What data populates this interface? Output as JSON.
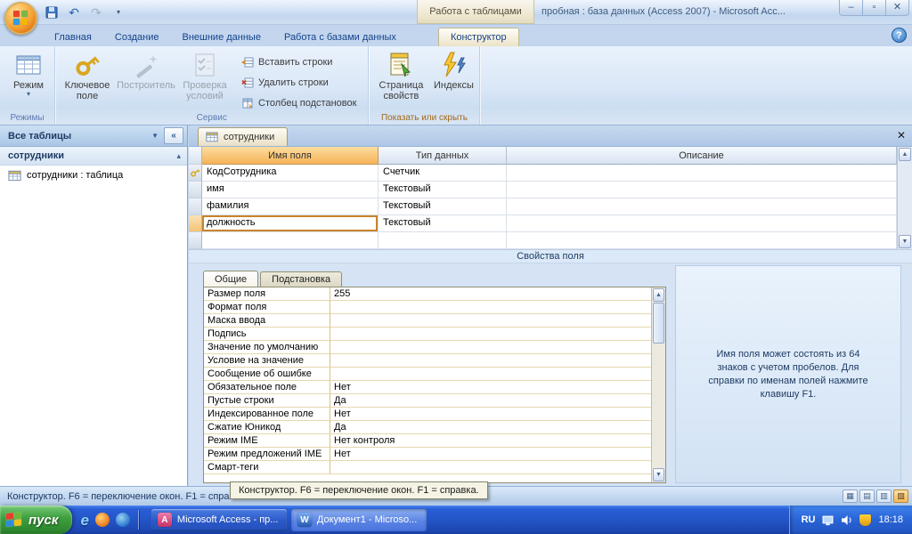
{
  "window": {
    "title": "пробная : база данных (Access 2007)  -  Microsoft Acc...",
    "contextual_tools_label": "Работа с таблицами"
  },
  "ribbon": {
    "tabs": [
      {
        "label": "Главная",
        "active": false
      },
      {
        "label": "Создание",
        "active": false
      },
      {
        "label": "Внешние данные",
        "active": false
      },
      {
        "label": "Работа с базами данных",
        "active": false
      }
    ],
    "contextual_tab": {
      "label": "Конструктор"
    },
    "views_group": {
      "label": "Режимы",
      "view_button": "Режим"
    },
    "tools_group": {
      "label": "Сервис",
      "primary_key": "Ключевое поле",
      "builder": "Построитель",
      "test_validation": "Проверка условий",
      "insert_rows": "Вставить строки",
      "delete_rows": "Удалить строки",
      "lookup_column": "Столбец подстановок"
    },
    "show_hide_group": {
      "label": "Показать или скрыть",
      "property_sheet": "Страница свойств",
      "indexes": "Индексы"
    }
  },
  "nav_pane": {
    "title": "Все таблицы",
    "group_header": "сотрудники",
    "item_label": "сотрудники : таблица"
  },
  "document": {
    "tab_label": "сотрудники",
    "grid": {
      "headers": [
        "Имя поля",
        "Тип данных",
        "Описание"
      ],
      "rows": [
        {
          "name": "КодСотрудника",
          "type": "Счетчик",
          "key": true,
          "selected": false
        },
        {
          "name": "имя",
          "type": "Текстовый",
          "key": false,
          "selected": false
        },
        {
          "name": "фамилия",
          "type": "Текстовый",
          "key": false,
          "selected": false
        },
        {
          "name": "должность",
          "type": "Текстовый",
          "key": false,
          "selected": true
        }
      ]
    },
    "field_properties_caption": "Свойства поля",
    "properties": {
      "tabs": [
        {
          "label": "Общие",
          "active": true
        },
        {
          "label": "Подстановка",
          "active": false
        }
      ],
      "rows": [
        {
          "label": "Размер поля",
          "value": "255"
        },
        {
          "label": "Формат поля",
          "value": ""
        },
        {
          "label": "Маска ввода",
          "value": ""
        },
        {
          "label": "Подпись",
          "value": ""
        },
        {
          "label": "Значение по умолчанию",
          "value": ""
        },
        {
          "label": "Условие на значение",
          "value": ""
        },
        {
          "label": "Сообщение об ошибке",
          "value": ""
        },
        {
          "label": "Обязательное поле",
          "value": "Нет"
        },
        {
          "label": "Пустые строки",
          "value": "Да"
        },
        {
          "label": "Индексированное поле",
          "value": "Нет"
        },
        {
          "label": "Сжатие Юникод",
          "value": "Да"
        },
        {
          "label": "Режим IME",
          "value": "Нет контроля"
        },
        {
          "label": "Режим предложений IME",
          "value": "Нет"
        },
        {
          "label": "Смарт-теги",
          "value": ""
        }
      ],
      "help_text": "Имя поля может состоять из 64 знаков с учетом пробелов.  Для справки по именам полей нажмите клавишу F1."
    }
  },
  "status_bar": {
    "text": "Конструктор.  F6 = переключение окон.  F1 = справка.",
    "tooltip": "Конструктор.  F6 = переключение окон.  F1 = справка."
  },
  "taskbar": {
    "start_label": "пуск",
    "buttons": {
      "access": "Microsoft Access - пр...",
      "word": "Документ1 - Microso..."
    },
    "tray": {
      "language": "RU",
      "time": "18:18"
    }
  }
}
